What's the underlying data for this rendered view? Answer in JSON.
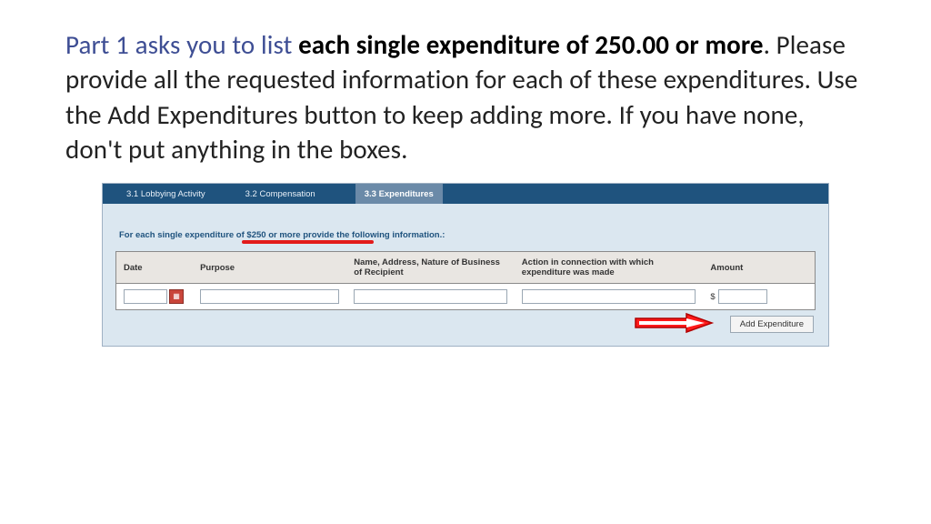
{
  "instruction": {
    "lead": "Part 1 asks you to list ",
    "emph": "each single expenditure of 250.00 or more",
    "rest": ".  Please provide all the requested information for each of these expenditures.  Use the Add Expenditures button to keep adding more. If you have none, don't put anything in the boxes."
  },
  "tabs": {
    "t1": "3.1 Lobbying Activity",
    "t2": "3.2 Compensation",
    "t3": "3.3 Expenditures"
  },
  "hint": "For each single expenditure of $250 or more provide the following information.:",
  "headers": {
    "date": "Date",
    "purpose": "Purpose",
    "name": "Name, Address, Nature of Business of Recipient",
    "action": "Action in connection with which expenditure was made",
    "amount": "Amount"
  },
  "row": {
    "dollar": "$"
  },
  "buttons": {
    "add": "Add Expenditure"
  }
}
